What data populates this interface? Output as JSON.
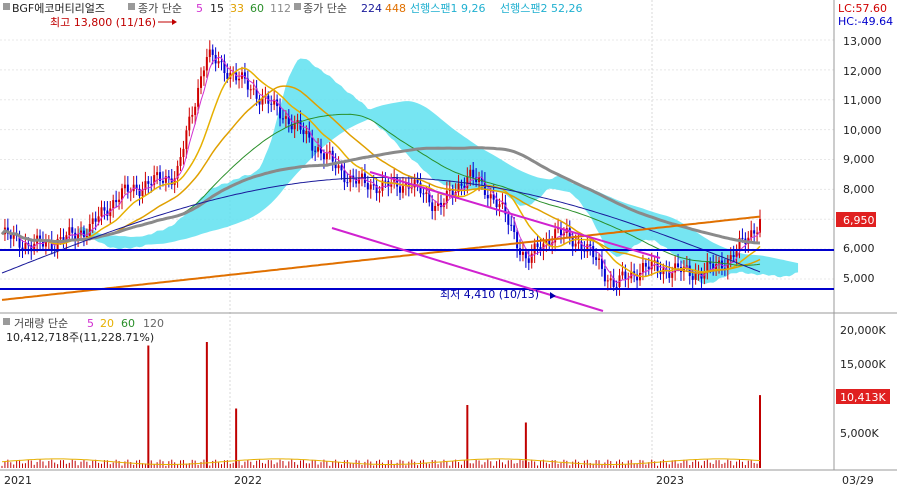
{
  "legend": {
    "symbol": "BGF에코머티리얼즈",
    "close_ma_label": "종가 단순",
    "ma_periods": [
      "5",
      "15",
      "33",
      "60",
      "112"
    ],
    "close_ma_label2": "종가 단순",
    "ma_periods2": [
      "224",
      "448"
    ],
    "span1": "선행스팬1 9,26",
    "span2": "선행스팬2 52,26"
  },
  "volume_legend": {
    "label": "거래량 단순",
    "periods": [
      "5",
      "20",
      "60",
      "120"
    ],
    "value": "10,412,718주(11,228.71%)"
  },
  "top_right": {
    "lc": "LC:57.60",
    "hc": "HC:-49.64"
  },
  "annotations": {
    "high": "최고 13,800 (11/16)",
    "low": "최저 4,410 (10/13)",
    "last_price": "6,950",
    "last_volume": "10,413K"
  },
  "date_labels": [
    {
      "text": "2021"
    },
    {
      "text": "2022"
    },
    {
      "text": "2023"
    },
    {
      "text": "03/29"
    }
  ],
  "colors": {
    "ma5": "#d12fd1",
    "ma15": "#e6b000",
    "ma33": "#e0a000",
    "ma60": "#2a8f2a",
    "ma112": "#8a8a8a",
    "ma224": "#1a1a9a",
    "ma448": "#e07000",
    "cloud": "#5ee0f0",
    "trend": "#d022d0",
    "hline": "#0000cc",
    "candle_up": "#d00000",
    "candle_down": "#0000d0",
    "volume": "#c00000"
  },
  "chart_data": [
    {
      "type": "candlestick",
      "title": "BGF에코머티리얼즈",
      "y_ticks": [
        "13,000",
        "12,000",
        "11,000",
        "10,000",
        "9,000",
        "8,000",
        "6,950",
        "6,000",
        "5,000"
      ],
      "ylim": [
        4000,
        13900
      ],
      "overlays": [
        "MA5",
        "MA15",
        "MA33",
        "MA60",
        "MA112",
        "MA224",
        "MA448",
        "Ichimoku Cloud"
      ],
      "horizontal_lines": [
        5950,
        4620
      ],
      "close_series": [
        {
          "x": "2021-01",
          "y": 6500
        },
        {
          "x": "2021-02",
          "y": 6100
        },
        {
          "x": "2021-03",
          "y": 6300
        },
        {
          "x": "2021-04",
          "y": 6700
        },
        {
          "x": "2021-05",
          "y": 7800
        },
        {
          "x": "2021-06",
          "y": 8200
        },
        {
          "x": "2021-07",
          "y": 8500
        },
        {
          "x": "2021-08",
          "y": 12500
        },
        {
          "x": "2021-09",
          "y": 11800
        },
        {
          "x": "2021-10",
          "y": 11000
        },
        {
          "x": "2021-11",
          "y": 10200
        },
        {
          "x": "2021-12",
          "y": 9200
        },
        {
          "x": "2022-01",
          "y": 8300
        },
        {
          "x": "2022-02",
          "y": 8100
        },
        {
          "x": "2022-03",
          "y": 8200
        },
        {
          "x": "2022-04",
          "y": 7400
        },
        {
          "x": "2022-05",
          "y": 8500
        },
        {
          "x": "2022-06",
          "y": 7600
        },
        {
          "x": "2022-07",
          "y": 5600
        },
        {
          "x": "2022-08",
          "y": 6600
        },
        {
          "x": "2022-09",
          "y": 6100
        },
        {
          "x": "2022-10",
          "y": 4800
        },
        {
          "x": "2022-11",
          "y": 5400
        },
        {
          "x": "2022-12",
          "y": 5300
        },
        {
          "x": "2023-01",
          "y": 5200
        },
        {
          "x": "2023-02",
          "y": 5700
        },
        {
          "x": "2023-03",
          "y": 6950
        }
      ]
    },
    {
      "type": "bar",
      "title": "거래량",
      "y_ticks": [
        "20,000K",
        "15,000K",
        "10,413K",
        "5,000K"
      ],
      "ylim": [
        0,
        22000
      ],
      "unit": "K",
      "spikes": [
        {
          "x": "2021-06",
          "value": 17500
        },
        {
          "x": "2021-08",
          "value": 18000
        },
        {
          "x": "2021-09",
          "value": 8500
        },
        {
          "x": "2022-05",
          "value": 9000
        },
        {
          "x": "2022-07",
          "value": 6500
        },
        {
          "x": "2023-03",
          "value": 10413
        }
      ]
    }
  ]
}
